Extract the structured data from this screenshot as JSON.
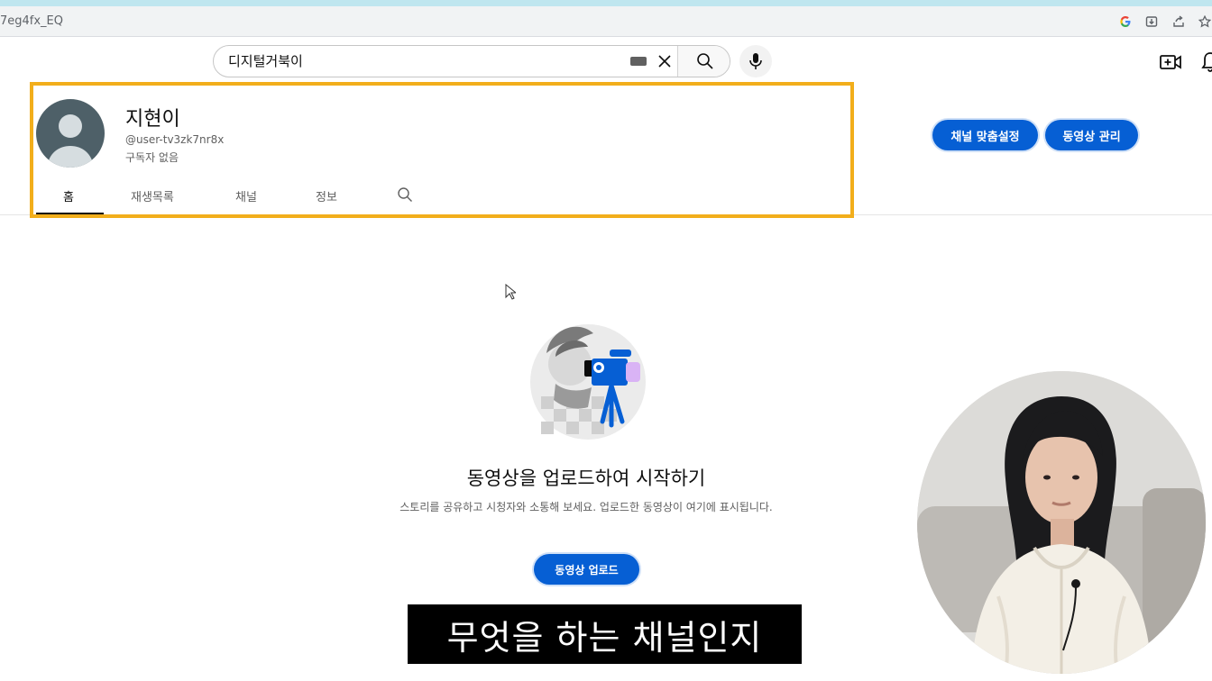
{
  "browser": {
    "url_fragment": "7eg4fx_EQ",
    "icons": [
      "google-icon",
      "install-icon",
      "share-icon",
      "star-icon"
    ]
  },
  "header": {
    "search_value": "디지털거북이",
    "icons": [
      "keyboard-icon",
      "clear-icon",
      "search-icon",
      "mic-icon",
      "create-video-icon",
      "bell-icon"
    ]
  },
  "channel": {
    "name": "지현이",
    "handle": "@user-tv3zk7nr8x",
    "subscribers": "구독자 없음",
    "customize_label": "채널 맞춤설정",
    "manage_label": "동영상 관리"
  },
  "tabs": [
    {
      "label": "홈",
      "active": true
    },
    {
      "label": "재생목록",
      "active": false
    },
    {
      "label": "채널",
      "active": false
    },
    {
      "label": "정보",
      "active": false
    }
  ],
  "empty_state": {
    "title": "동영상을 업로드하여 시작하기",
    "description": "스토리를 공유하고 시청자와 소통해 보세요. 업로드한 동영상이 여기에 표시됩니다.",
    "upload_label": "동영상 업로드"
  },
  "overlay": {
    "subtitle": "무엇을 하는 채널인지"
  },
  "colors": {
    "accent": "#065fd4",
    "highlight_border": "#f2ae1b"
  }
}
